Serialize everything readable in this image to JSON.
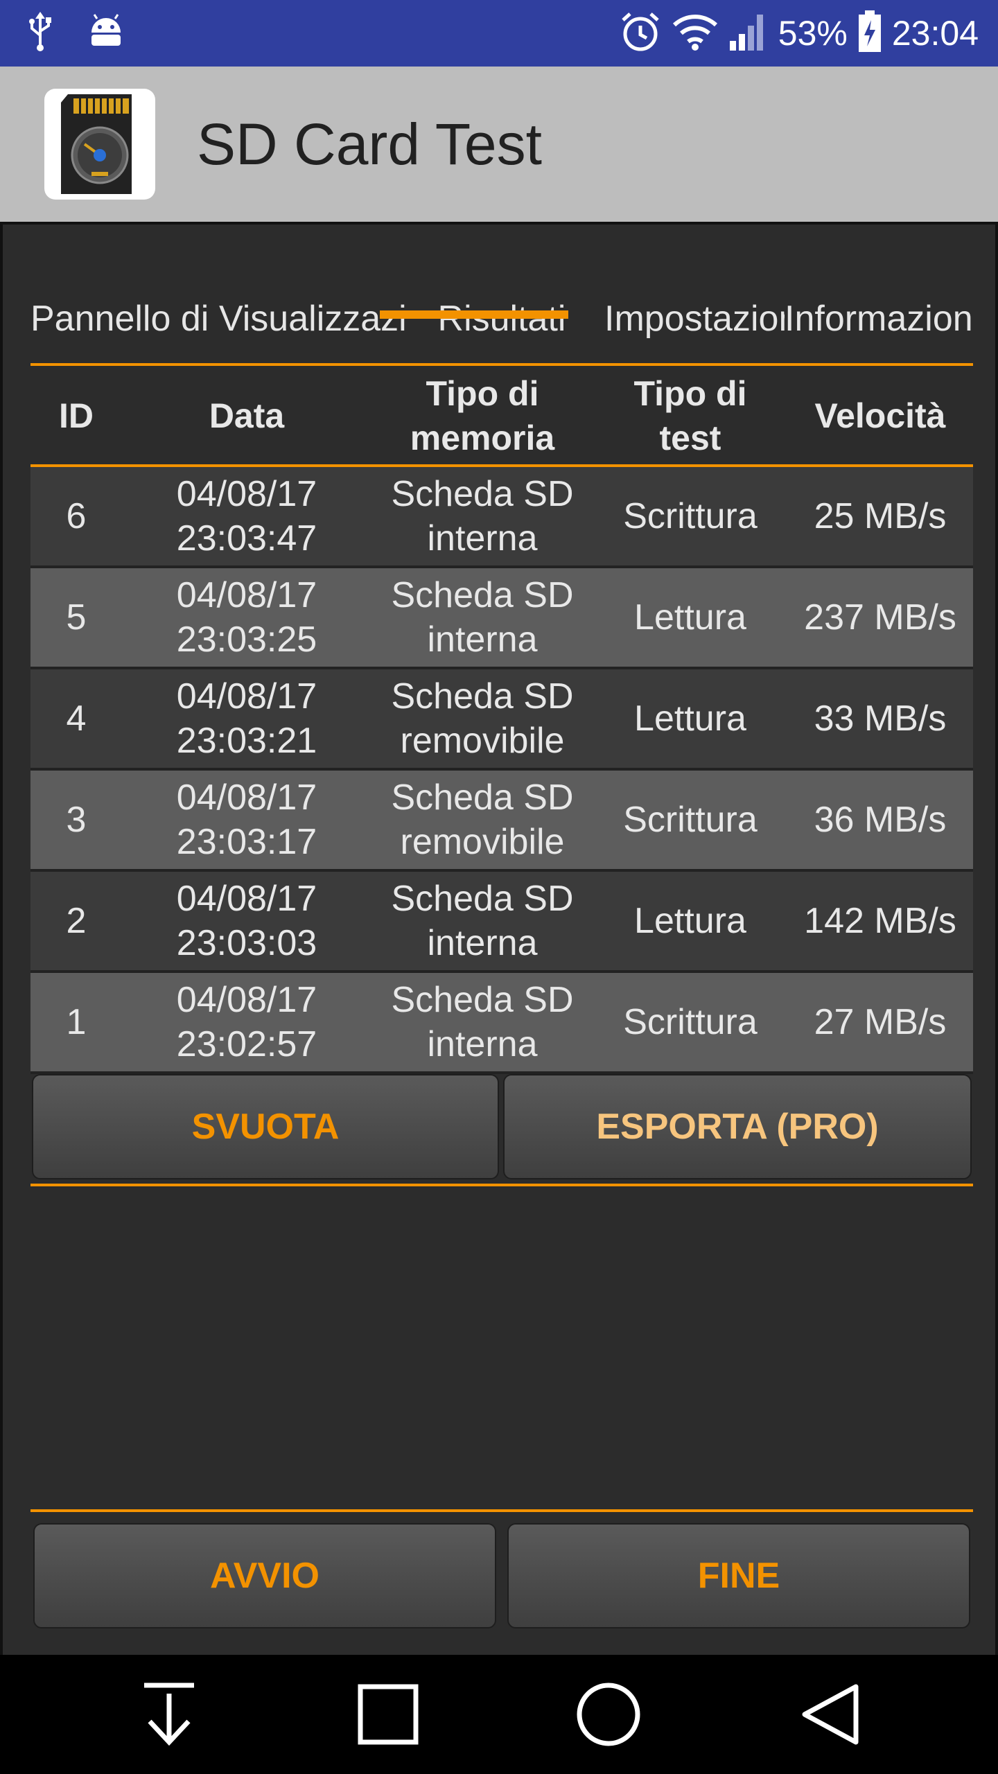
{
  "status_bar": {
    "battery_percent": "53%",
    "time": "23:04",
    "icons": [
      "usb-icon",
      "android-icon",
      "alarm-icon",
      "wifi-icon",
      "signal-icon",
      "battery-charging-icon"
    ]
  },
  "app_bar": {
    "title": "SD Card Test",
    "logo_icon": "sd-card-speedometer-icon"
  },
  "tabs": [
    {
      "label": "Pannello di controllo",
      "selected": false
    },
    {
      "label": "Visualizzazione",
      "selected": false
    },
    {
      "label": "Risultati",
      "selected": true
    },
    {
      "label": "Impostazioni",
      "selected": false
    },
    {
      "label": "Informazioni",
      "selected": false
    }
  ],
  "table": {
    "headers": {
      "id": "ID",
      "date": "Data",
      "memory_line1": "Tipo di",
      "memory_line2": "memoria",
      "test_line1": "Tipo di",
      "test_line2": "test",
      "speed": "Velocità"
    },
    "rows": [
      {
        "id": "6",
        "date": "04/08/17",
        "time": "23:03:47",
        "mem1": "Scheda SD",
        "mem2": "interna",
        "test": "Scrittura",
        "speed": "25 MB/s"
      },
      {
        "id": "5",
        "date": "04/08/17",
        "time": "23:03:25",
        "mem1": "Scheda SD",
        "mem2": "interna",
        "test": "Lettura",
        "speed": "237 MB/s"
      },
      {
        "id": "4",
        "date": "04/08/17",
        "time": "23:03:21",
        "mem1": "Scheda SD",
        "mem2": "removibile",
        "test": "Lettura",
        "speed": "33 MB/s"
      },
      {
        "id": "3",
        "date": "04/08/17",
        "time": "23:03:17",
        "mem1": "Scheda SD",
        "mem2": "removibile",
        "test": "Scrittura",
        "speed": "36 MB/s"
      },
      {
        "id": "2",
        "date": "04/08/17",
        "time": "23:03:03",
        "mem1": "Scheda SD",
        "mem2": "interna",
        "test": "Lettura",
        "speed": "142 MB/s"
      },
      {
        "id": "1",
        "date": "04/08/17",
        "time": "23:02:57",
        "mem1": "Scheda SD",
        "mem2": "interna",
        "test": "Scrittura",
        "speed": "27 MB/s"
      }
    ]
  },
  "actions": {
    "clear_label": "SVUOTA",
    "export_label": "ESPORTA (PRO)"
  },
  "controls": {
    "start_label": "AVVIO",
    "end_label": "FINE"
  },
  "colors": {
    "status_bar": "#303F9F",
    "app_bar": "#BDBDBD",
    "accent": "#F39200",
    "background": "#2C2C2C"
  },
  "nav_icons": [
    "notifications-down-icon",
    "recents-square-icon",
    "home-circle-icon",
    "back-triangle-icon"
  ]
}
